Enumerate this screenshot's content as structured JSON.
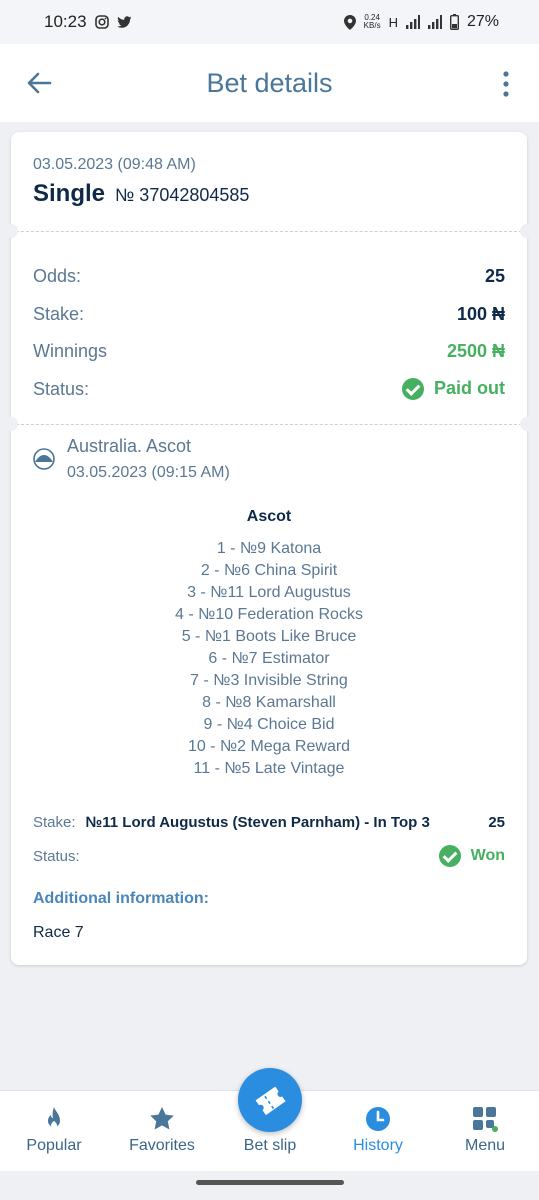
{
  "status_bar": {
    "time": "10:23",
    "net_speed": "0.24",
    "net_unit": "KB/s",
    "network_type": "H",
    "battery": "27%"
  },
  "header": {
    "title": "Bet details"
  },
  "bet": {
    "date": "03.05.2023 (09:48 AM)",
    "type": "Single",
    "number": "№ 37042804585"
  },
  "summary": {
    "odds_label": "Odds:",
    "odds_value": "25",
    "stake_label": "Stake:",
    "stake_value": "100 ₦",
    "winnings_label": "Winnings",
    "winnings_value": "2500 ₦",
    "status_label": "Status:",
    "status_value": "Paid out"
  },
  "event": {
    "title": "Australia. Ascot",
    "date": "03.05.2023 (09:15 AM)",
    "race_title": "Ascot",
    "runners": [
      "1 - №9 Katona",
      "2 - №6 China Spirit",
      "3 - №11 Lord Augustus",
      "4 - №10 Federation Rocks",
      "5 - №1 Boots Like Bruce",
      "6 - №7 Estimator",
      "7 - №3 Invisible String",
      "8 - №8 Kamarshall",
      "9 - №4 Choice Bid",
      "10 - №2 Mega Reward",
      "11 - №5 Late Vintage"
    ],
    "stake_label": "Stake:",
    "selection": "№11 Lord Augustus (Steven Parnham) - In Top 3",
    "selection_odds": "25",
    "status_label": "Status:",
    "status_value": "Won",
    "additional_label": "Additional information:",
    "additional_value": "Race 7"
  },
  "nav": {
    "popular": "Popular",
    "favorites": "Favorites",
    "bet_slip": "Bet slip",
    "history": "History",
    "menu": "Menu"
  },
  "colors": {
    "accent": "#2b8de0",
    "success": "#46b060",
    "title": "#4a7699"
  }
}
